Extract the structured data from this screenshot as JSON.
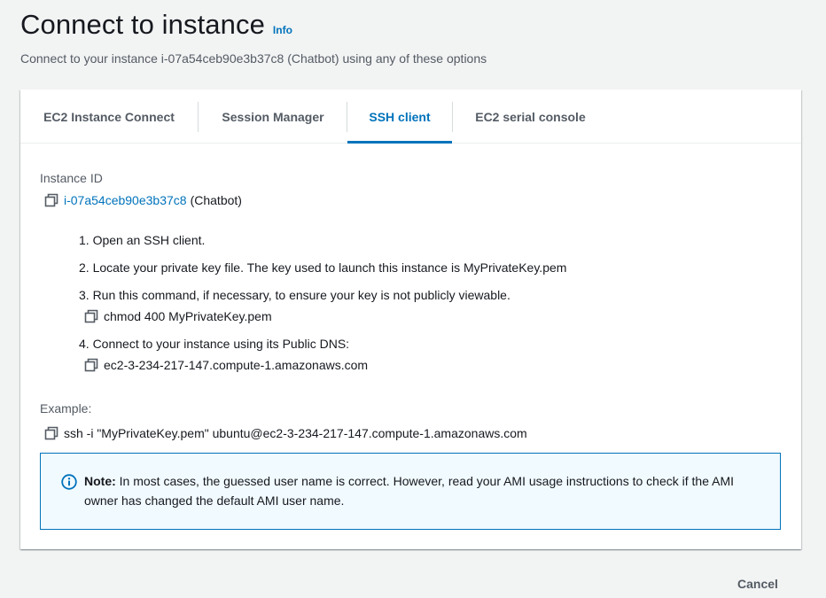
{
  "header": {
    "title": "Connect to instance",
    "info_label": "Info",
    "subtitle": "Connect to your instance i-07a54ceb90e3b37c8 (Chatbot) using any of these options"
  },
  "tabs": [
    {
      "label": "EC2 Instance Connect"
    },
    {
      "label": "Session Manager"
    },
    {
      "label": "SSH client",
      "active": true
    },
    {
      "label": "EC2 serial console"
    }
  ],
  "ssh": {
    "instance_id_label": "Instance ID",
    "instance_id": "i-07a54ceb90e3b37c8",
    "instance_name": "(Chatbot)",
    "steps": [
      "1. Open an SSH client.",
      "2. Locate your private key file. The key used to launch this instance is MyPrivateKey.pem",
      "3. Run this command, if necessary, to ensure your key is not publicly viewable.",
      "4. Connect to your instance using its Public DNS:"
    ],
    "chmod_command": "chmod 400 MyPrivateKey.pem",
    "public_dns": "ec2-3-234-217-147.compute-1.amazonaws.com",
    "example_label": "Example:",
    "example_command": "ssh -i \"MyPrivateKey.pem\" ubuntu@ec2-3-234-217-147.compute-1.amazonaws.com",
    "note_bold": "Note:",
    "note_text": " In most cases, the guessed user name is correct. However, read your AMI usage instructions to check if the AMI owner has changed the default AMI user name."
  },
  "footer": {
    "cancel_label": "Cancel"
  },
  "colors": {
    "accent": "#0073bb",
    "note_background": "#f1faff",
    "page_background": "#f2f3f3"
  }
}
